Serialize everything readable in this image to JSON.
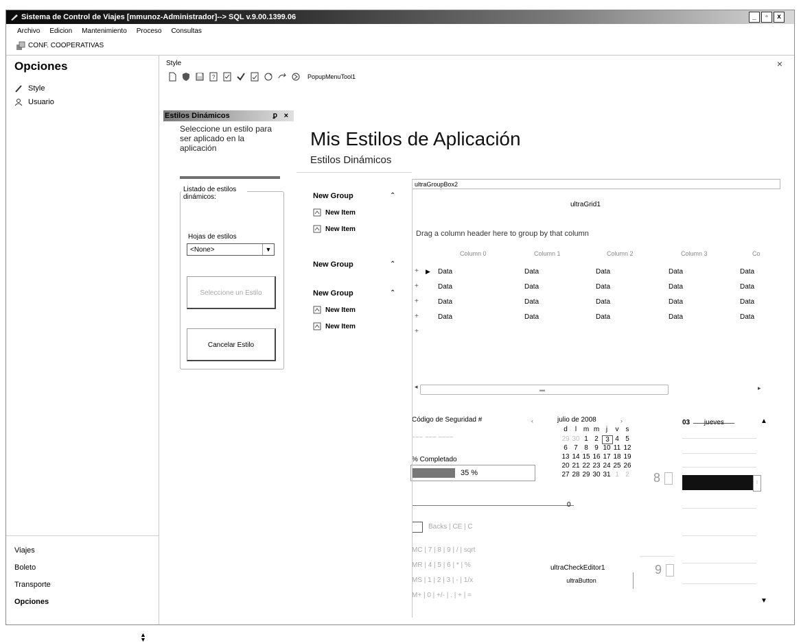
{
  "window": {
    "title": "Sistema de Control de Viajes [mmunoz-Administrador]--> SQL v.9.00.1399.06",
    "btn_min": "_",
    "btn_max": "▫",
    "btn_close": "x"
  },
  "menu": [
    "Archivo",
    "Edicion",
    "Mantenimiento",
    "Proceso",
    "Consultas"
  ],
  "toolbar": {
    "coop_label": "CONF. COOPERATIVAS"
  },
  "nav": {
    "header": "Opciones",
    "items": [
      "Style",
      "Usuario"
    ],
    "bottom_items": [
      "Viajes",
      "Boleto",
      "Transporte",
      "Opciones"
    ]
  },
  "style_panel": {
    "title": "Style",
    "close": "×",
    "popup_tool": "PopupMenuTool1"
  },
  "dock": {
    "title": "Estilos Dinámicos",
    "pin": "ꝑ",
    "close": "×",
    "description": "Seleccione un estilo para ser aplicado en la aplicación",
    "group_label": "Listado de estilos dinámicos:",
    "hojas_label": "Hojas de estilos",
    "combo_value": "<None>",
    "select_button": "Seleccione un Estilo",
    "cancel_button": "Cancelar Estilo"
  },
  "heading": {
    "title": "Mis Estilos de Aplicación",
    "subtitle": "Estilos Dinámicos"
  },
  "explorer": {
    "groups": [
      "New Group",
      "New Group",
      "New Group"
    ],
    "item_label": "New Item",
    "chevron": "⌃"
  },
  "groupbox_label": "ultraGroupBox2",
  "grid": {
    "caption": "ultraGrid1",
    "drag_hint": "Drag a column header here to group by that column",
    "columns": [
      "Column 0",
      "Column 1",
      "Column 2",
      "Column 3",
      "Co"
    ],
    "cell": "Data",
    "rows": 4
  },
  "widgets": {
    "codigo_label": "Código de Seguridad #",
    "codigo_mask": "___ ___ ____",
    "completado_label": "% Completado",
    "progress": 35,
    "progress_text": "35 %",
    "slider_value": "0",
    "calendar": {
      "title": "julio de 2008",
      "dow": [
        "d",
        "l",
        "m",
        "m",
        "j",
        "v",
        "s"
      ],
      "weeks": [
        [
          "29",
          "30",
          "1",
          "2",
          "3",
          "4",
          "5"
        ],
        [
          "6",
          "7",
          "8",
          "9",
          "10",
          "11",
          "12"
        ],
        [
          "13",
          "14",
          "15",
          "16",
          "17",
          "18",
          "19"
        ],
        [
          "20",
          "21",
          "22",
          "23",
          "24",
          "25",
          "26"
        ],
        [
          "27",
          "28",
          "29",
          "30",
          "31",
          "1",
          "2"
        ]
      ],
      "selected": "3"
    },
    "spin_8": "8",
    "spin_9": "9",
    "date_day": "03",
    "date_dow": "jueves",
    "check_editor": "ultraCheckEditor1",
    "ultra_button": "ultraButton",
    "calc_rows": [
      "Backs | CE | C",
      "MC | 7 | 8 | 9 | / | sqrt",
      "MR | 4 | 5 | 6 | * | %",
      "MS | 1 | 2 | 3 | - | 1/x",
      "M+ | 0 | +/- | . | + | ="
    ]
  },
  "colors": {
    "title_bar_start": "#0a0a0a",
    "title_bar_end": "#d8d8d8",
    "progress_fill": "#777777"
  }
}
